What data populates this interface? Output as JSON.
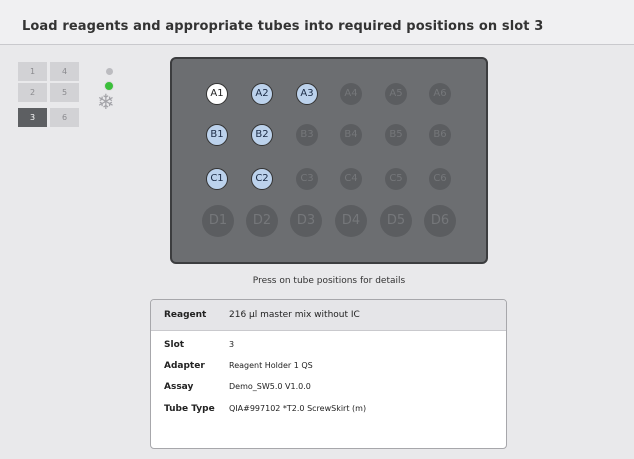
{
  "header": {
    "title": "Load reagents and appropriate tubes into required positions on slot 3"
  },
  "slots": [
    {
      "label": "1",
      "active": false
    },
    {
      "label": "4",
      "active": false
    },
    {
      "label": "2",
      "active": false
    },
    {
      "label": "5",
      "active": false
    },
    {
      "label": "3",
      "active": true
    },
    {
      "label": "6",
      "active": false
    }
  ],
  "icons": {
    "snowflake": "snowflake-icon"
  },
  "colors": {
    "selected_tube": "#ffffff",
    "loaded_tube": "#bcd2ec",
    "status_ok": "#3bbf3b",
    "active_slot": "#5d5f62"
  },
  "rack": {
    "rows": [
      {
        "id": "A",
        "tubes": [
          {
            "label": "A1",
            "state": "selected"
          },
          {
            "label": "A2",
            "state": "loaded"
          },
          {
            "label": "A3",
            "state": "loaded"
          },
          {
            "label": "A4",
            "state": "empty"
          },
          {
            "label": "A5",
            "state": "empty"
          },
          {
            "label": "A6",
            "state": "empty"
          }
        ]
      },
      {
        "id": "B",
        "tubes": [
          {
            "label": "B1",
            "state": "loaded"
          },
          {
            "label": "B2",
            "state": "loaded"
          },
          {
            "label": "B3",
            "state": "empty"
          },
          {
            "label": "B4",
            "state": "empty"
          },
          {
            "label": "B5",
            "state": "empty"
          },
          {
            "label": "B6",
            "state": "empty"
          }
        ]
      },
      {
        "id": "C",
        "tubes": [
          {
            "label": "C1",
            "state": "loaded"
          },
          {
            "label": "C2",
            "state": "loaded"
          },
          {
            "label": "C3",
            "state": "empty"
          },
          {
            "label": "C4",
            "state": "empty"
          },
          {
            "label": "C5",
            "state": "empty"
          },
          {
            "label": "C6",
            "state": "empty"
          }
        ]
      },
      {
        "id": "D",
        "tubes": [
          {
            "label": "D1",
            "state": "empty"
          },
          {
            "label": "D2",
            "state": "empty"
          },
          {
            "label": "D3",
            "state": "empty"
          },
          {
            "label": "D4",
            "state": "empty"
          },
          {
            "label": "D5",
            "state": "empty"
          },
          {
            "label": "D6",
            "state": "empty"
          }
        ]
      }
    ],
    "hint": "Press on tube positions for details"
  },
  "details": {
    "reagent_label": "Reagent",
    "reagent_value": "216 µl master mix without IC",
    "rows": [
      {
        "label": "Slot",
        "value": "3"
      },
      {
        "label": "Adapter",
        "value": "Reagent Holder 1 QS"
      },
      {
        "label": "Assay",
        "value": "Demo_SW5.0 V1.0.0"
      },
      {
        "label": "Tube Type",
        "value": "QIA#997102 *T2.0 ScrewSkirt  (m)"
      }
    ]
  }
}
